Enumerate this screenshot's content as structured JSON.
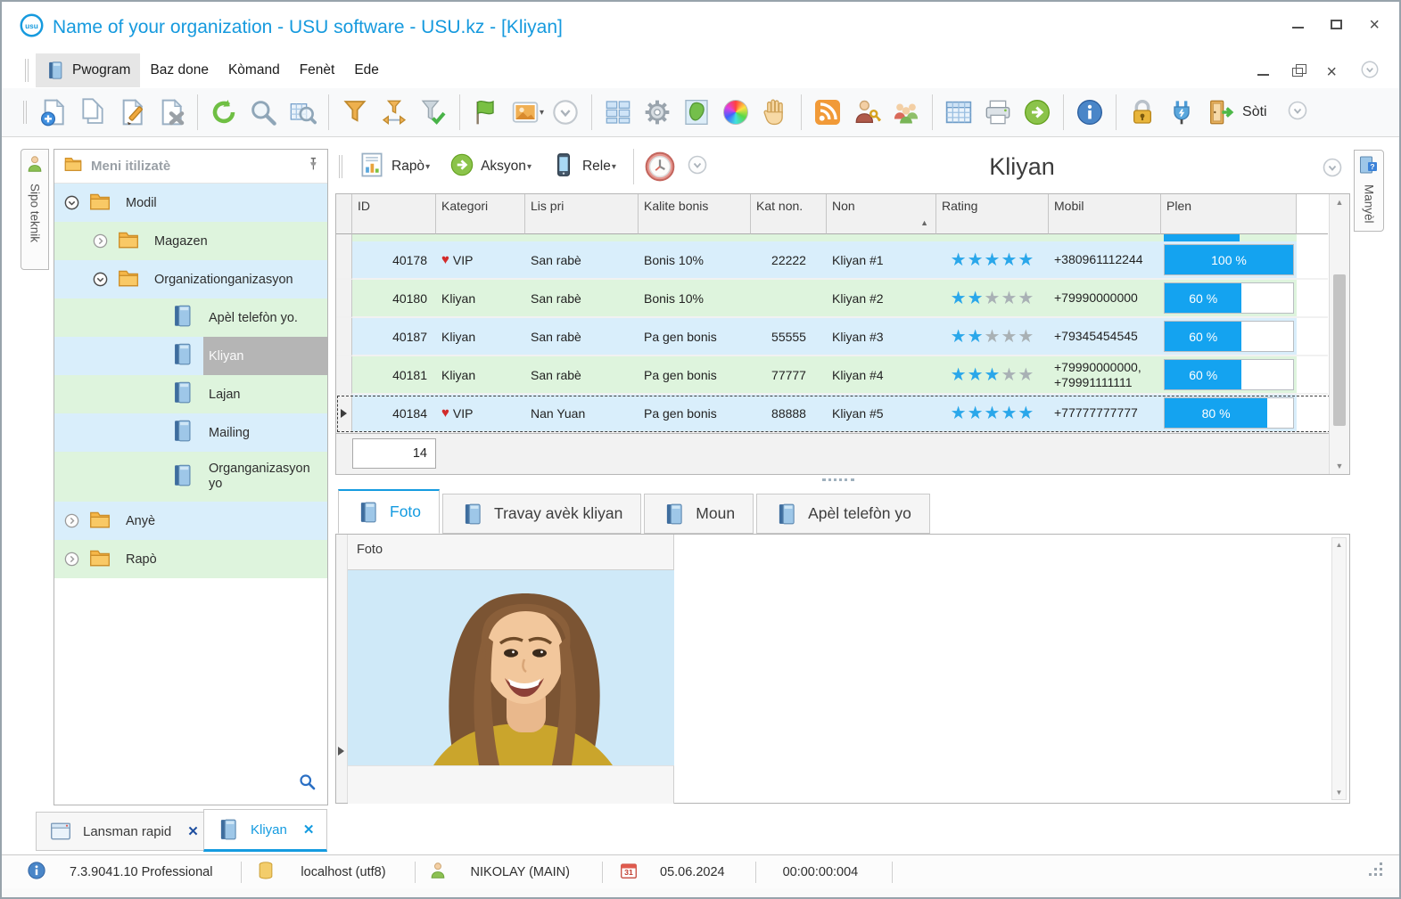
{
  "window": {
    "title": "Name of your organization - USU software - USU.kz - [Kliyan]",
    "logo_text": "usu"
  },
  "menu": {
    "items": [
      "Pwogram",
      "Baz done",
      "Kòmand",
      "Fenèt",
      "Ede"
    ],
    "active_index": 0
  },
  "toolbar": {
    "items": [
      "new-record",
      "copy",
      "edit",
      "delete",
      "|",
      "refresh",
      "search",
      "search-grid",
      "|",
      "filter",
      "filter-window",
      "filter-apply",
      "|",
      "flag",
      "image",
      "caret",
      "chevron-circle",
      "|",
      "tiles",
      "gear",
      "map",
      "colors",
      "hand",
      "|",
      "rss",
      "user-key",
      "users",
      "|",
      "table",
      "print",
      "go",
      "|",
      "info",
      "|",
      "lock",
      "plug"
    ],
    "exit_label": "Sòti"
  },
  "left_tab": {
    "label": "Sipo teknik"
  },
  "right_tab": {
    "label": "Manyèl"
  },
  "sidebar": {
    "header": "Meni itilizatè",
    "tree": [
      {
        "label": "Modil",
        "icon": "folder",
        "level": 0,
        "expander": "open",
        "bg": "blue"
      },
      {
        "label": "Magazen",
        "icon": "folder",
        "level": 1,
        "expander": "closed",
        "bg": "green"
      },
      {
        "label": "Organizationganizasyon",
        "icon": "folder",
        "level": 1,
        "expander": "open",
        "bg": "blue"
      },
      {
        "label": "Apèl telefòn yo.",
        "icon": "book",
        "level": 2,
        "expander": null,
        "bg": "green"
      },
      {
        "label": "Kliyan",
        "icon": "book",
        "level": 2,
        "expander": null,
        "bg": "blue",
        "selected": true
      },
      {
        "label": "Lajan",
        "icon": "book",
        "level": 2,
        "expander": null,
        "bg": "green"
      },
      {
        "label": "Mailing",
        "icon": "book",
        "level": 2,
        "expander": null,
        "bg": "blue"
      },
      {
        "label": "Organganizasyon yo",
        "icon": "book",
        "level": 2,
        "expander": null,
        "bg": "green",
        "tall": true
      },
      {
        "label": "Anyè",
        "icon": "folder",
        "level": 0,
        "expander": "closed",
        "bg": "blue"
      },
      {
        "label": "Rapò",
        "icon": "folder",
        "level": 0,
        "expander": "closed",
        "bg": "green"
      }
    ]
  },
  "panel_toolbar": {
    "report": "Rapò",
    "action": "Aksyon",
    "call": "Rele",
    "title": "Kliyan"
  },
  "grid": {
    "columns": [
      "ID",
      "Kategori",
      "Lis pri",
      "Kalite bonis",
      "Kat non.",
      "Non",
      "Rating",
      "Mobil",
      "Plen"
    ],
    "sort_column_index": 5,
    "partial_row": {
      "bg": "green",
      "plen_fill": 58
    },
    "rows": [
      {
        "id": "40178",
        "vip": true,
        "kategori": "VIP",
        "lis_pri": "San rabè",
        "kalite": "Bonis 10%",
        "kat_non": "22222",
        "non": "Kliyan #1",
        "rating": 5,
        "mobil": [
          "+380961112244"
        ],
        "plen": 100,
        "plen_label": "100 %",
        "bg": "blue",
        "selected": false
      },
      {
        "id": "40180",
        "vip": false,
        "kategori": "Kliyan",
        "lis_pri": "San rabè",
        "kalite": "Bonis 10%",
        "kat_non": "",
        "non": "Kliyan #2",
        "rating": 2,
        "mobil": [
          "+79990000000"
        ],
        "plen": 60,
        "plen_label": "60 %",
        "bg": "green",
        "selected": false
      },
      {
        "id": "40187",
        "vip": false,
        "kategori": "Kliyan",
        "lis_pri": "San rabè",
        "kalite": "Pa gen bonis",
        "kat_non": "55555",
        "non": "Kliyan #3",
        "rating": 2,
        "mobil": [
          "+79345454545"
        ],
        "plen": 60,
        "plen_label": "60 %",
        "bg": "blue",
        "selected": false
      },
      {
        "id": "40181",
        "vip": false,
        "kategori": "Kliyan",
        "lis_pri": "San rabè",
        "kalite": "Pa gen bonis",
        "kat_non": "77777",
        "non": "Kliyan #4",
        "rating": 3,
        "mobil": [
          "+79990000000,",
          "+79991111111"
        ],
        "plen": 60,
        "plen_label": "60 %",
        "bg": "green",
        "selected": false
      },
      {
        "id": "40184",
        "vip": true,
        "kategori": "VIP",
        "lis_pri": "Nan Yuan",
        "kalite": "Pa gen bonis",
        "kat_non": "88888",
        "non": "Kliyan #5",
        "rating": 5,
        "mobil": [
          "+77777777777"
        ],
        "plen": 80,
        "plen_label": "80 %",
        "bg": "blue",
        "selected": true
      }
    ],
    "count_label": "14"
  },
  "detail_tabs": [
    {
      "label": "Foto",
      "active": true
    },
    {
      "label": "Travay avèk kliyan",
      "active": false
    },
    {
      "label": "Moun",
      "active": false
    },
    {
      "label": "Apèl telefòn yo",
      "active": false
    }
  ],
  "foto_panel": {
    "column_header": "Foto"
  },
  "window_tabs": [
    {
      "label": "Lansman rapid",
      "icon": "window-frame",
      "active": false
    },
    {
      "label": "Kliyan",
      "icon": "book",
      "active": true
    }
  ],
  "statusbar": {
    "version": "7.3.9041.10 Professional",
    "database": "localhost (utf8)",
    "user": "NIKOLAY (MAIN)",
    "calendar_day": "31",
    "date": "05.06.2024",
    "timer": "00:00:00:004"
  },
  "colors": {
    "accent_blue": "#169ade",
    "row_blue": "#d9eefb",
    "row_green": "#def4dd",
    "progress_blue": "#14a3f0",
    "star_blue": "#2aa7ea",
    "heart_red": "#d22b2b",
    "selected_gray": "#b5b5b5"
  }
}
